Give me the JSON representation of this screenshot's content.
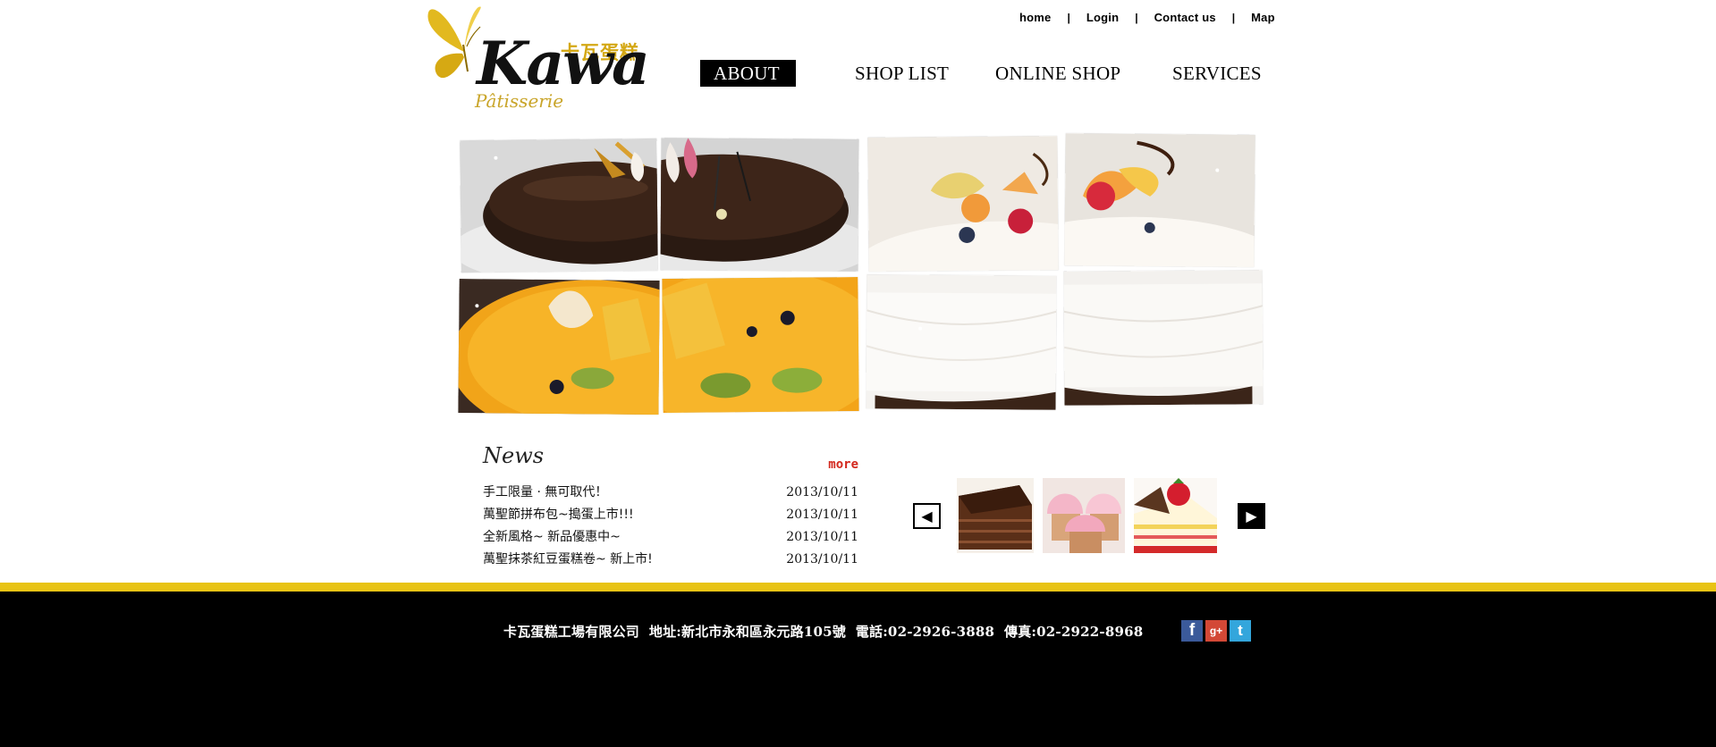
{
  "brand": {
    "script": "Kawa",
    "chinese": "卡瓦蛋糕",
    "subtitle": "Pâtisserie",
    "accent": "#d4a815"
  },
  "topbar": {
    "links": [
      "home",
      "Login",
      "Contact us",
      "Map"
    ],
    "separator": "|"
  },
  "nav": {
    "items": [
      "ABOUT",
      "SHOP LIST",
      "ONLINE SHOP",
      "SERVICES"
    ],
    "active": "ABOUT"
  },
  "hero": {
    "tiles": [
      "chocolate-cake",
      "fruit-cream-cake",
      "mango-kiwi-cake",
      "white-cream-cake"
    ]
  },
  "news": {
    "title": "News",
    "more": "more",
    "items": [
      {
        "text": "手工限量 · 無可取代！",
        "date": "2013/10/11"
      },
      {
        "text": "萬聖節拼布包~搗蛋上市!!!",
        "date": "2013/10/11"
      },
      {
        "text": "全新風格~ 新品優惠中~",
        "date": "2013/10/11"
      },
      {
        "text": "萬聖抹茶紅豆蛋糕卷~ 新上市!",
        "date": "2013/10/11"
      }
    ]
  },
  "carousel": {
    "prev_icon": "◀",
    "next_icon": "▶",
    "thumbs": [
      "chocolate-layer-cake",
      "pink-cupcakes",
      "strawberry-shortcake"
    ]
  },
  "footer": {
    "company": "卡瓦蛋糕工場有限公司",
    "address": "地址:新北市永和區永元路105號",
    "phone": "電話:02-2926-3888",
    "fax": "傳真:02-2922-8968",
    "social": [
      {
        "name": "facebook",
        "glyph": "f"
      },
      {
        "name": "google-plus",
        "glyph": "g+"
      },
      {
        "name": "twitter",
        "glyph": "t"
      }
    ],
    "band_color": "#e8c314",
    "bg_color": "#000000"
  }
}
